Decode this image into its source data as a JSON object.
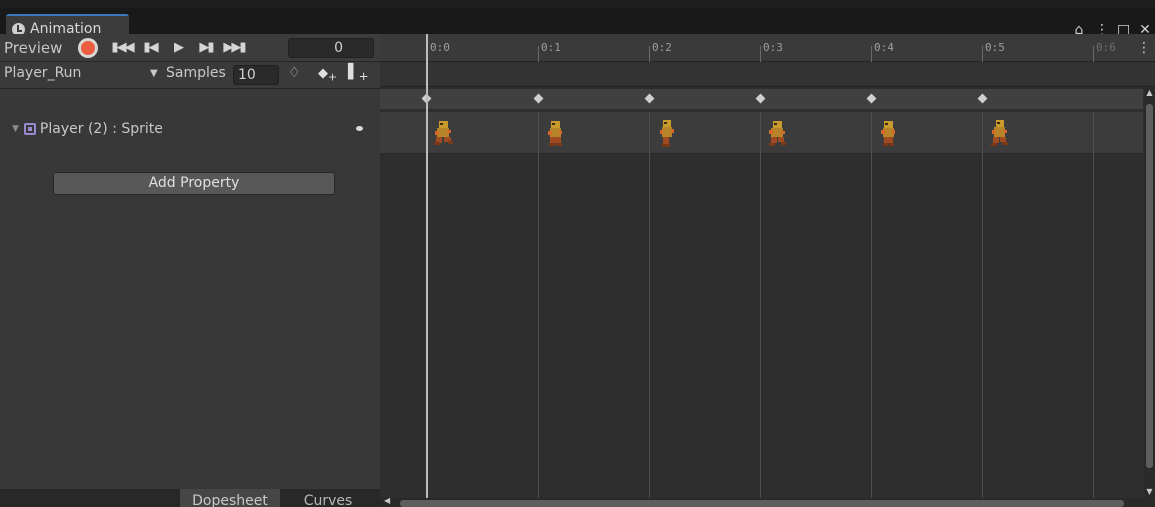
{
  "window": {
    "tab_label": "Animation",
    "tab_icon": "animation-clock-icon",
    "controls": [
      "lock-icon",
      "kebab-menu-icon",
      "maximize-icon",
      "close-icon"
    ]
  },
  "toolbar": {
    "preview_label": "Preview",
    "record_color": "#ec5d3f",
    "playback_icons": [
      "first-key-icon",
      "prev-key-icon",
      "play-icon",
      "next-key-icon",
      "last-key-icon"
    ],
    "frame_value": "0"
  },
  "clip_bar": {
    "clip_name": "Player_Run",
    "samples_label": "Samples",
    "samples_value": "10",
    "icons": [
      "filter-keyframes-icon",
      "add-keyframe-icon",
      "add-event-icon"
    ]
  },
  "hierarchy": {
    "property_label": "Player (2) : Sprite",
    "add_property_label": "Add Property"
  },
  "bottom_tabs": {
    "dopesheet": "Dopesheet",
    "curves": "Curves"
  },
  "timeline": {
    "ticks": [
      "0:0",
      "0:1",
      "0:2",
      "0:3",
      "0:4",
      "0:5",
      "0:6"
    ],
    "keyframe_times": [
      "0:0",
      "0:1",
      "0:2",
      "0:3",
      "0:4",
      "0:5"
    ],
    "playhead_time": "0:0"
  }
}
